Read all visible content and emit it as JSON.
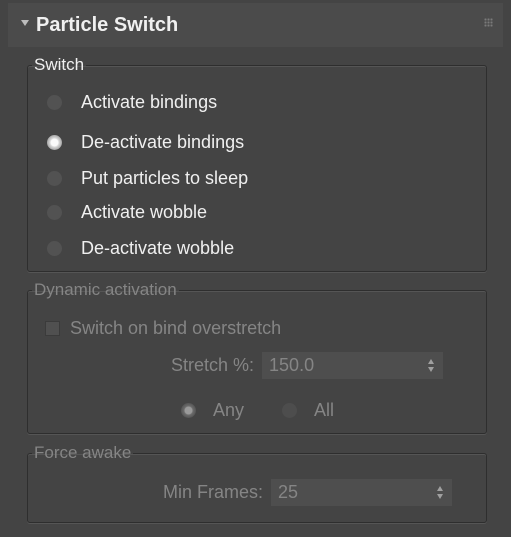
{
  "rollout": {
    "title": "Particle Switch",
    "collapse_icon": "triangle-down-icon",
    "grip_icon": "drag-grip-icon"
  },
  "switch_group": {
    "title": "Switch",
    "selected_index": 1,
    "options": [
      {
        "label": "Activate bindings",
        "checked": false
      },
      {
        "label": "De-activate bindings",
        "checked": true
      },
      {
        "label": "Put particles to sleep",
        "checked": false
      },
      {
        "label": "Activate wobble",
        "checked": false
      },
      {
        "label": "De-activate wobble",
        "checked": false
      }
    ]
  },
  "dynamic_group": {
    "title": "Dynamic activation",
    "enabled": false,
    "checkbox_label": "Switch on bind overstretch",
    "checkbox_checked": false,
    "stretch_label": "Stretch %:",
    "stretch_value": "150.0",
    "any_label": "Any",
    "all_label": "All",
    "any_checked": true,
    "all_checked": false
  },
  "force_group": {
    "title": "Force awake",
    "enabled": false,
    "min_frames_label": "Min Frames:",
    "min_frames_value": "25"
  },
  "colors": {
    "panel_bg": "#444444",
    "text": "#f0f0f0",
    "disabled_text": "#858585"
  }
}
